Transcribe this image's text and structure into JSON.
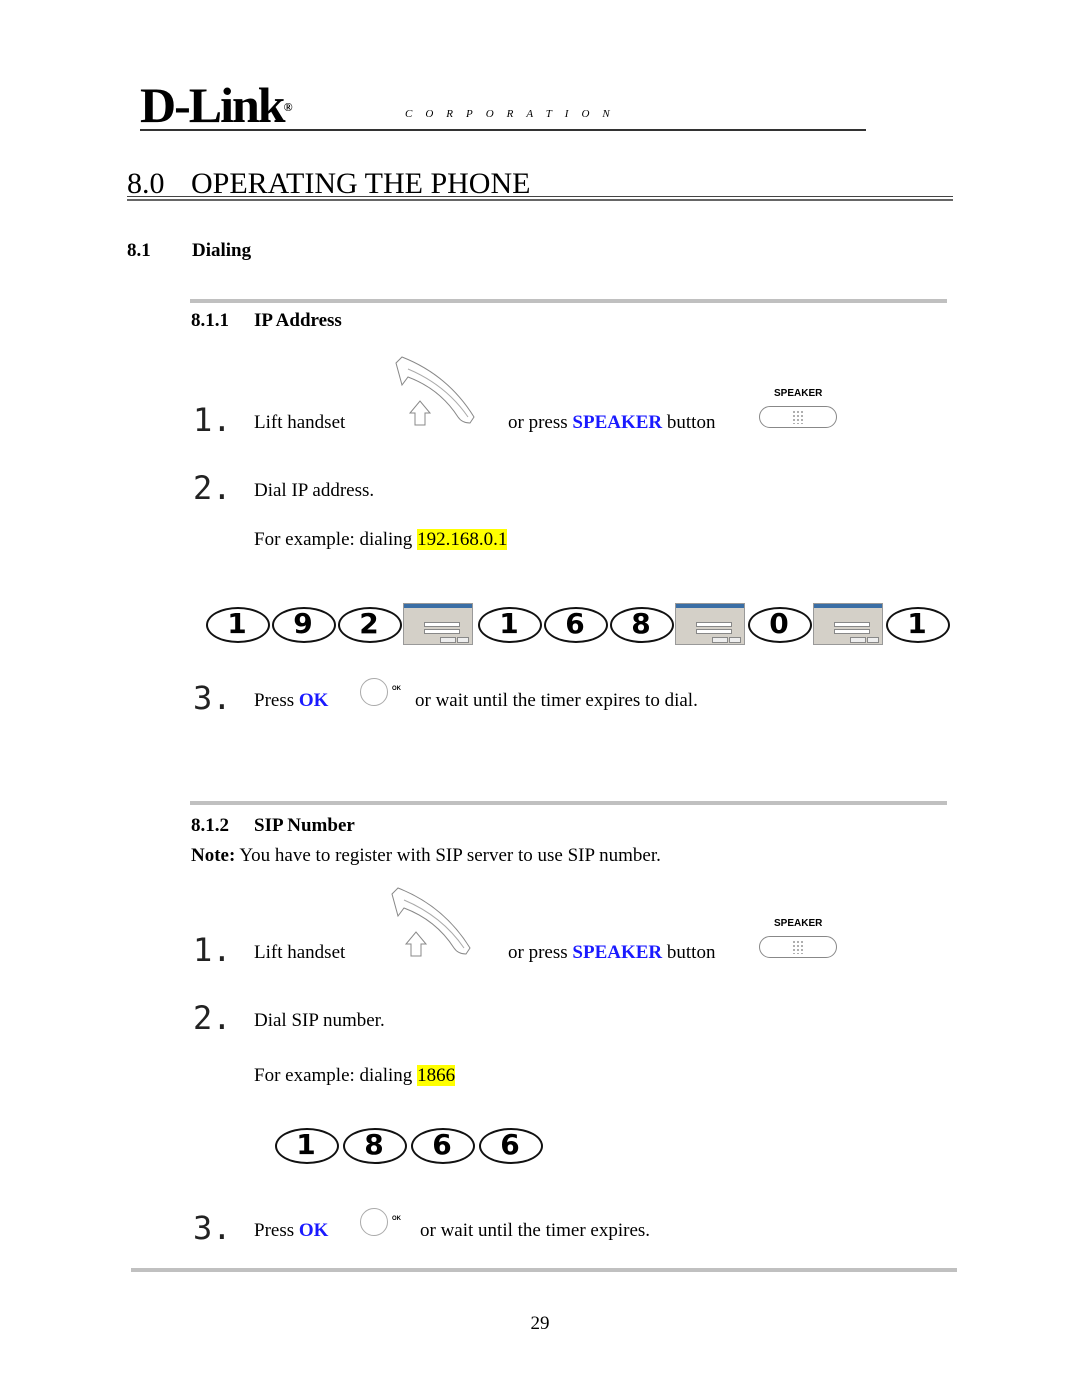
{
  "header": {
    "logo_text": "D-Link",
    "logo_mark": "®",
    "corporation": "CORPORATION"
  },
  "chapter": {
    "number": "8.0",
    "title": "OPERATING THE PHONE"
  },
  "section": {
    "number": "8.1",
    "title": "Dialing"
  },
  "ip_address": {
    "number": "8.1.1",
    "title": "IP Address",
    "step1": {
      "num": "1.",
      "text": "Lift handset",
      "or_press": "or press ",
      "speaker": "SPEAKER",
      "button": " button",
      "speaker_label": "SPEAKER"
    },
    "step2": {
      "num": "2.",
      "text": "Dial IP address.",
      "example_prefix": "For example: dialing ",
      "example_value": "192.168.0.1"
    },
    "keys": [
      "1",
      "9",
      "2",
      "dialog",
      "1",
      "6",
      "8",
      "dialog",
      "0",
      "dialog",
      "1"
    ],
    "step3": {
      "num": "3.",
      "press": "Press ",
      "ok": "OK",
      "ok_label": "OK",
      "rest": "or wait until the timer expires to dial."
    }
  },
  "sip_number": {
    "number": "8.1.2",
    "title": "SIP Number",
    "note_label": "Note:",
    "note_text": " You have to register with SIP server to use SIP number.",
    "step1": {
      "num": "1.",
      "text": "Lift handset",
      "or_press": "or press ",
      "speaker": "SPEAKER",
      "button": " button",
      "speaker_label": "SPEAKER"
    },
    "step2": {
      "num": "2.",
      "text": "Dial SIP number.",
      "example_prefix": "For example: dialing ",
      "example_value": "1866"
    },
    "keys": [
      "1",
      "8",
      "6",
      "6"
    ],
    "step3": {
      "num": "3.",
      "press": "Press ",
      "ok": "OK",
      "ok_label": "OK",
      "rest": "or wait until the timer expires."
    }
  },
  "page_number": "29"
}
